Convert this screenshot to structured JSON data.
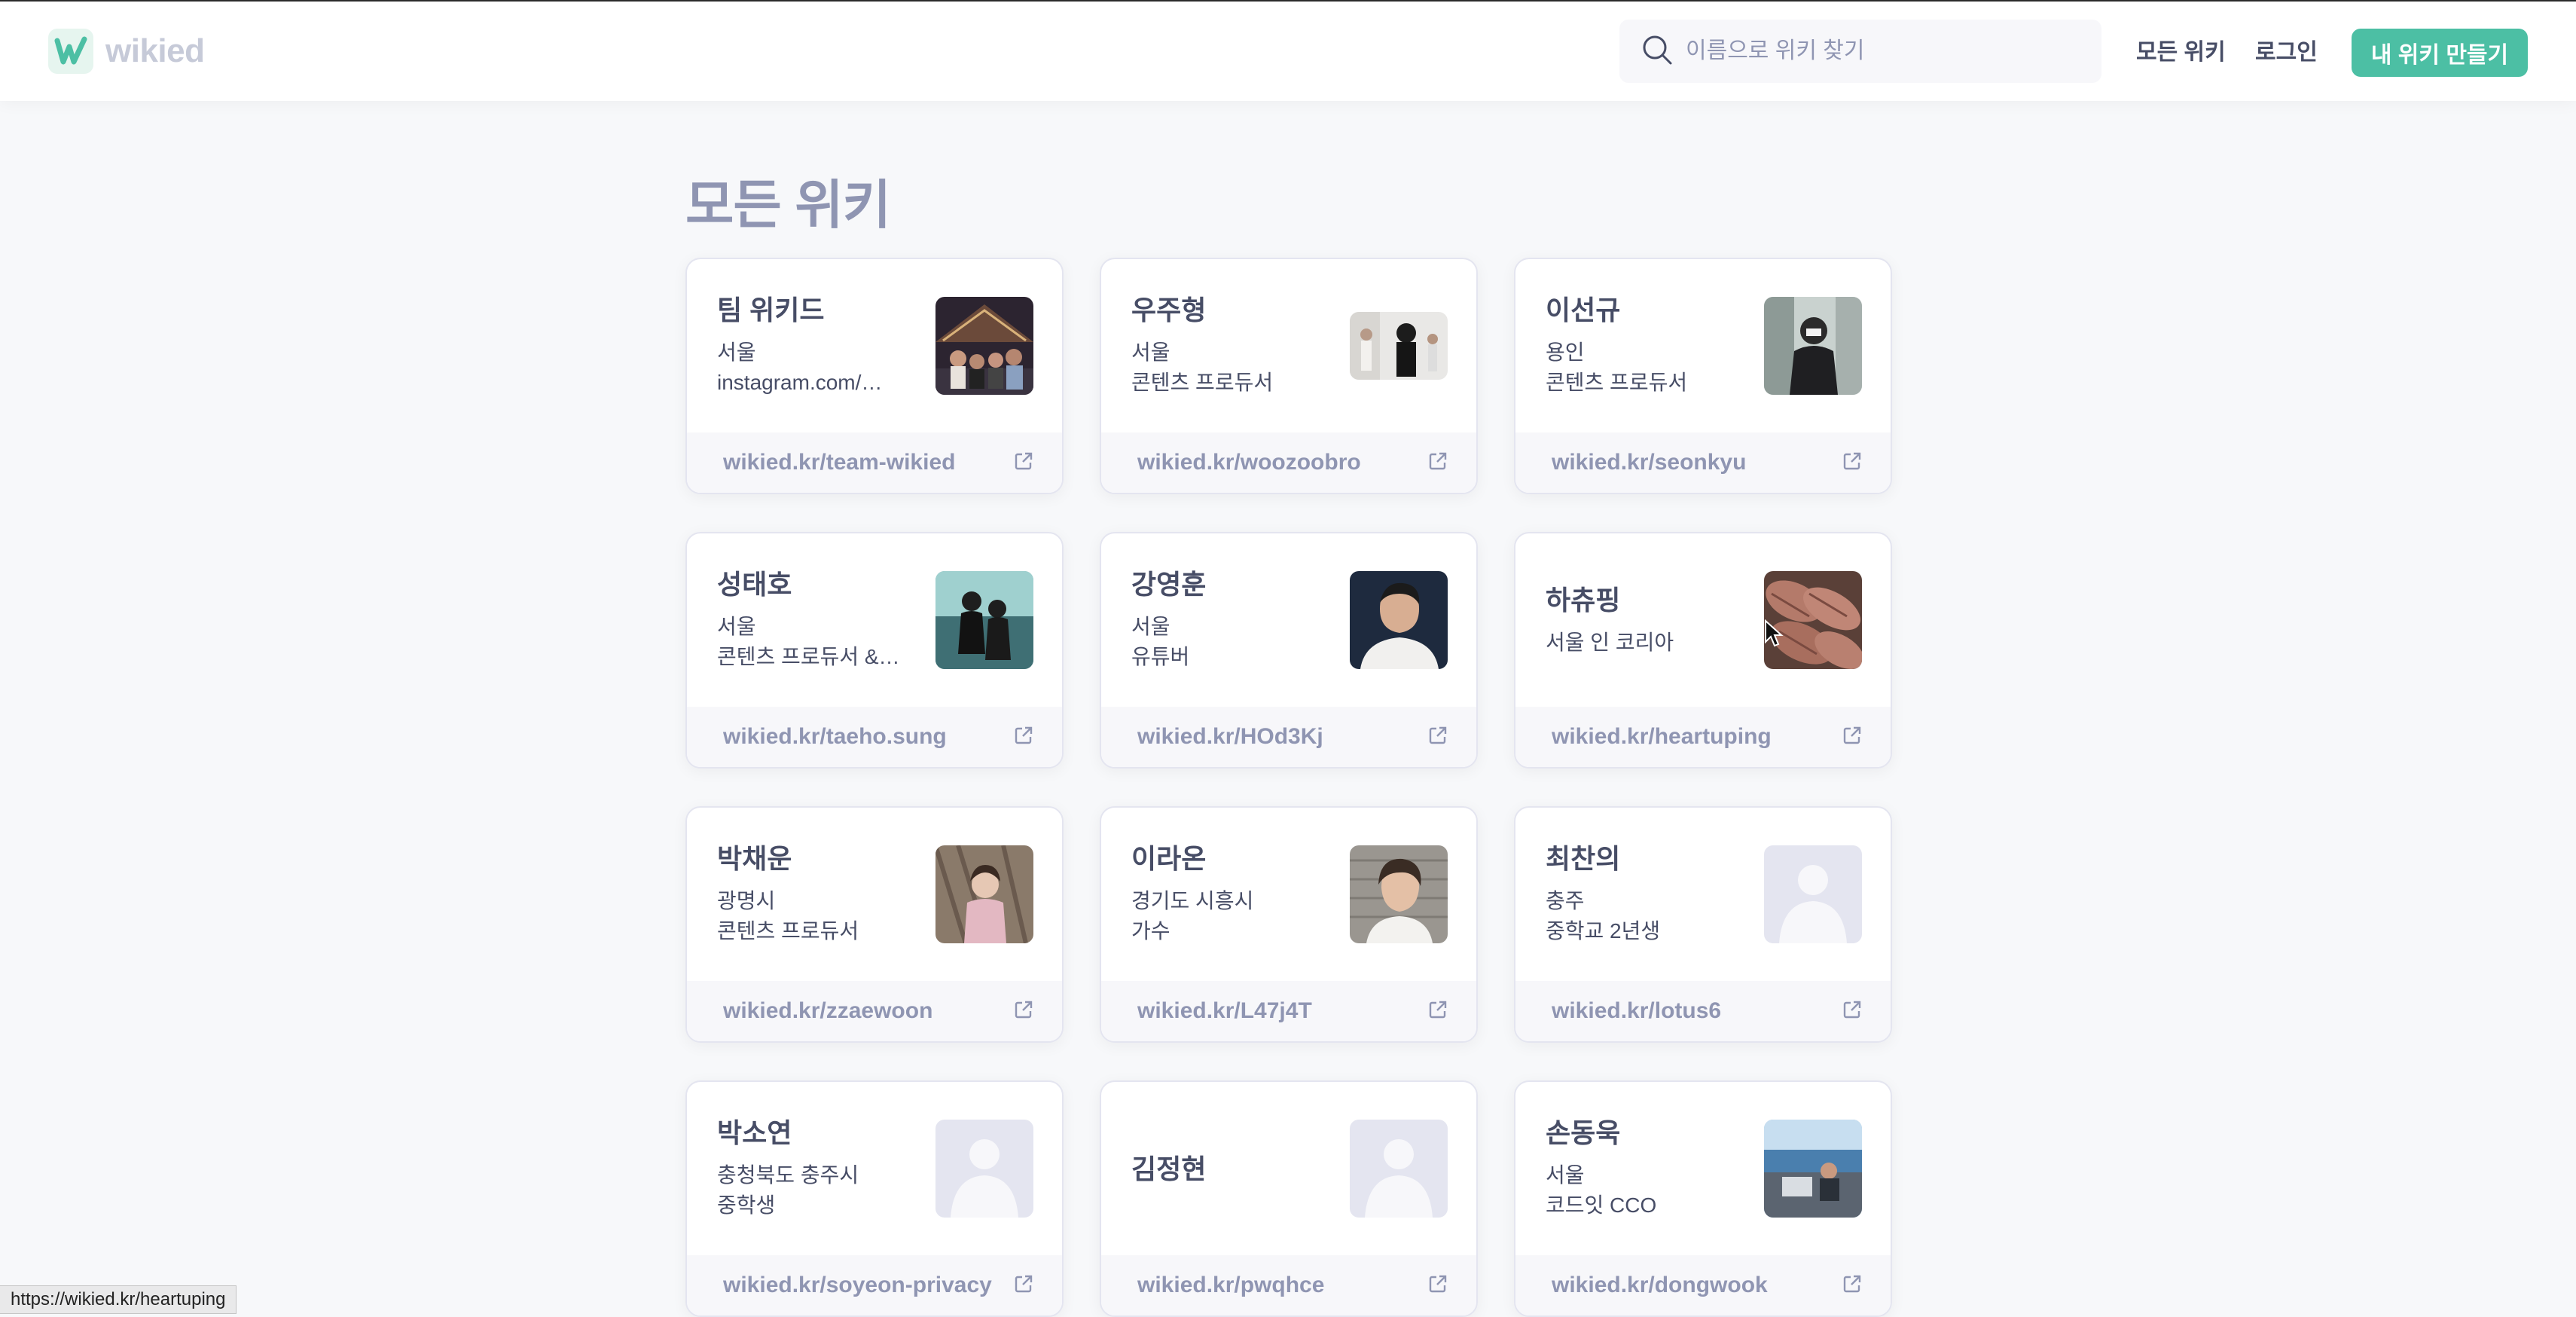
{
  "header": {
    "logo_text": "wikied",
    "search_placeholder": "이름으로 위키 찾기",
    "nav_all_wikis": "모든 위키",
    "nav_login": "로그인",
    "create_button": "내 위키 만들기"
  },
  "main": {
    "title": "모든 위키",
    "cards": [
      {
        "name": "팀 위키드",
        "line1": "서울",
        "line2": "instagram.com/…",
        "link": "wikied.kr/team-wikied",
        "image": "group-photo"
      },
      {
        "name": "우주형",
        "line1": "서울",
        "line2": "콘텐츠 프로듀서",
        "link": "wikied.kr/woozoobro",
        "image": "person-photo"
      },
      {
        "name": "이선규",
        "line1": "용인",
        "line2": "콘텐츠 프로듀서",
        "link": "wikied.kr/seonkyu",
        "image": "person-photo"
      },
      {
        "name": "성태호",
        "line1": "서울",
        "line2": "콘텐츠 프로듀서 &…",
        "link": "wikied.kr/taeho.sung",
        "image": "person-photo"
      },
      {
        "name": "강영훈",
        "line1": "서울",
        "line2": "유튜버",
        "link": "wikied.kr/HOd3Kj",
        "image": "person-photo"
      },
      {
        "name": "하츄핑",
        "line1": "서울 인 코리아",
        "line2": "",
        "link": "wikied.kr/heartuping",
        "image": "food-photo"
      },
      {
        "name": "박채운",
        "line1": "광명시",
        "line2": "콘텐츠 프로듀서",
        "link": "wikied.kr/zzaewoon",
        "image": "person-photo"
      },
      {
        "name": "이라온",
        "line1": "경기도 시흥시",
        "line2": "가수",
        "link": "wikied.kr/L47j4T",
        "image": "person-photo"
      },
      {
        "name": "최찬의",
        "line1": "충주",
        "line2": "중학교 2년생",
        "link": "wikied.kr/lotus6",
        "image": "default-avatar"
      },
      {
        "name": "박소연",
        "line1": "충청북도 충주시",
        "line2": "중학생",
        "link": "wikied.kr/soyeon-privacy",
        "image": "default-avatar"
      },
      {
        "name": "김정현",
        "line1": "",
        "line2": "",
        "link": "wikied.kr/pwqhce",
        "image": "default-avatar"
      },
      {
        "name": "손동욱",
        "line1": "서울",
        "line2": "코드잇 CCO",
        "link": "wikied.kr/dongwook",
        "image": "person-photo"
      }
    ]
  },
  "status_bar": {
    "url": "https://wikied.kr/heartuping"
  },
  "colors": {
    "accent": "#4cbfa4",
    "text": "#474d66",
    "muted": "#8f95b2",
    "background": "#f7f8fa"
  }
}
